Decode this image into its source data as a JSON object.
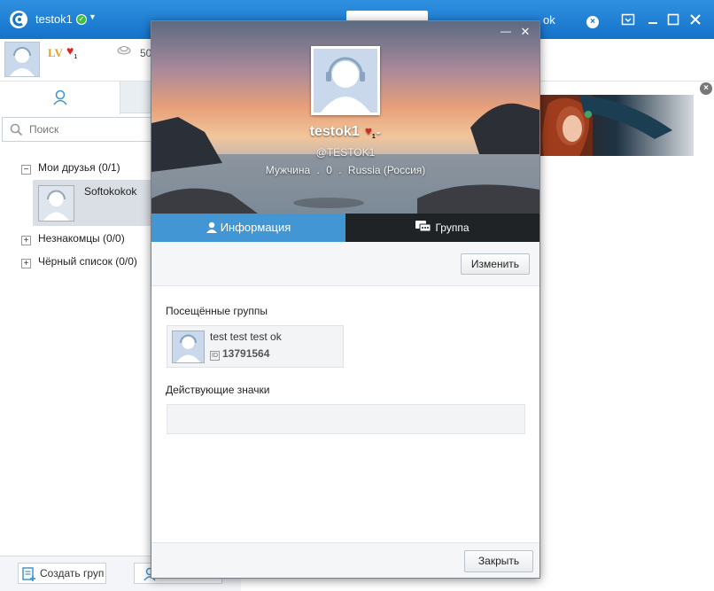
{
  "window": {
    "title": "testok1",
    "status_icon": "check-icon",
    "tab_right_partial": "ok",
    "controls": [
      "dropdown-icon",
      "minimize-icon",
      "maximize-icon",
      "close-icon"
    ]
  },
  "profile_bar": {
    "level": "LV",
    "heart_level": "1",
    "coin_value": "50"
  },
  "sidebar": {
    "search_placeholder": "Поиск",
    "groups": [
      {
        "label": "Мои друзья (0/1)",
        "expanded": true,
        "toggle": "−"
      },
      {
        "label": "Незнакомцы (0/0)",
        "expanded": false,
        "toggle": "+"
      },
      {
        "label": "Чёрный список (0/0)",
        "expanded": false,
        "toggle": "+"
      }
    ],
    "friend": {
      "name": "Softokokok"
    },
    "footer": {
      "create_group": "Создать груп"
    }
  },
  "popup": {
    "name": "testok1",
    "heart_level": "1",
    "login": "@TESTOK1",
    "meta": {
      "gender": "Мужчина",
      "age": "0",
      "country": "Russia (Россия)",
      "separator": "."
    },
    "tabs": {
      "info": "Информация",
      "group": "Группа"
    },
    "edit_label": "Изменить",
    "visited_groups_title": "Посещённые группы",
    "group_card": {
      "name": "test test test ok",
      "id": "13791564",
      "id_icon": "ID"
    },
    "badges_title": "Действующие значки",
    "close_label": "Закрыть"
  },
  "colors": {
    "titlebar": "#1a7bd0",
    "accent_tab": "#4296d4",
    "dark_tab": "#1f2326",
    "friend_selected": "#dadfe5"
  }
}
